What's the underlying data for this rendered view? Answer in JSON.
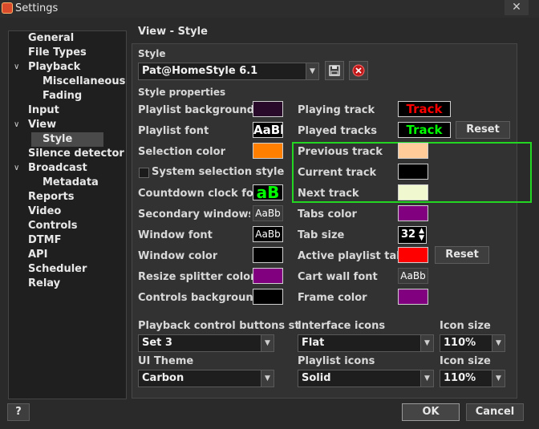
{
  "window": {
    "title": "Settings",
    "close_glyph": "✕"
  },
  "tree": {
    "items": [
      {
        "label": "General",
        "expander": ""
      },
      {
        "label": "File Types",
        "expander": ""
      },
      {
        "label": "Playback",
        "expander": "∨"
      },
      {
        "label": "Miscellaneous",
        "expander": ""
      },
      {
        "label": "Fading",
        "expander": ""
      },
      {
        "label": "Input",
        "expander": ""
      },
      {
        "label": "View",
        "expander": "∨"
      },
      {
        "label": "Style",
        "expander": ""
      },
      {
        "label": "Silence detector",
        "expander": ""
      },
      {
        "label": "Broadcast",
        "expander": "∨"
      },
      {
        "label": "Metadata",
        "expander": ""
      },
      {
        "label": "Reports",
        "expander": ""
      },
      {
        "label": "Video",
        "expander": ""
      },
      {
        "label": "Controls",
        "expander": ""
      },
      {
        "label": "DTMF",
        "expander": ""
      },
      {
        "label": "API",
        "expander": ""
      },
      {
        "label": "Scheduler",
        "expander": ""
      },
      {
        "label": "Relay",
        "expander": ""
      }
    ],
    "selected": "Style"
  },
  "main": {
    "section_title": "View - Style",
    "style_label": "Style",
    "style_value": "Pat@HomeStyle 6.1",
    "style_properties_label": "Style properties",
    "left_props": {
      "playlist_background": {
        "label": "Playlist background",
        "color": "#2a0a2a"
      },
      "playlist_font": {
        "label": "Playlist font",
        "sample": "AaBb"
      },
      "selection_color": {
        "label": "Selection color",
        "color": "#ff8000"
      },
      "system_selection_style": {
        "label": "System selection style"
      },
      "countdown_clock_font": {
        "label": "Countdown clock font",
        "sample": "aB"
      },
      "secondary_windows_font": {
        "label": "Secondary windows font",
        "sample": "AaBb"
      },
      "window_font": {
        "label": "Window font",
        "sample": "AaBb"
      },
      "window_color": {
        "label": "Window color",
        "color": "#000000"
      },
      "resize_splitter_color": {
        "label": "Resize splitter color",
        "color": "#800080"
      },
      "controls_background": {
        "label": "Controls background",
        "color": "#000000"
      }
    },
    "right_props": {
      "playing_track": {
        "label": "Playing track",
        "sample": "Track",
        "color": "#ff0000"
      },
      "played_tracks": {
        "label": "Played tracks",
        "sample": "Track",
        "color": "#00ff00"
      },
      "previous_track": {
        "label": "Previous track",
        "color": "#ffcc99"
      },
      "current_track": {
        "label": "Current track",
        "color": "#000000"
      },
      "next_track": {
        "label": "Next track",
        "color": "#f0f8d0"
      },
      "tabs_color": {
        "label": "Tabs color",
        "color": "#800080"
      },
      "tab_size": {
        "label": "Tab size",
        "value": "32"
      },
      "active_playlist_tab": {
        "label": "Active playlist tab",
        "color": "#ff0000"
      },
      "cart_wall_font": {
        "label": "Cart wall font",
        "sample": "AaBb"
      },
      "frame_color": {
        "label": "Frame color",
        "color": "#800080"
      }
    },
    "reset_label": "Reset",
    "reset2_label": "Reset",
    "bottom": {
      "playback_buttons_style": {
        "label": "Playback control buttons style",
        "value": "Set 3"
      },
      "interface_icons": {
        "label": "Interface icons",
        "value": "Flat"
      },
      "icon_size_1": {
        "label": "Icon size",
        "value": "110%"
      },
      "ui_theme": {
        "label": "UI Theme",
        "value": "Carbon"
      },
      "playlist_icons": {
        "label": "Playlist icons",
        "value": "Solid"
      },
      "icon_size_2": {
        "label": "Icon size",
        "value": "110%"
      }
    }
  },
  "footer": {
    "help_label": "?",
    "ok_label": "OK",
    "cancel_label": "Cancel"
  }
}
